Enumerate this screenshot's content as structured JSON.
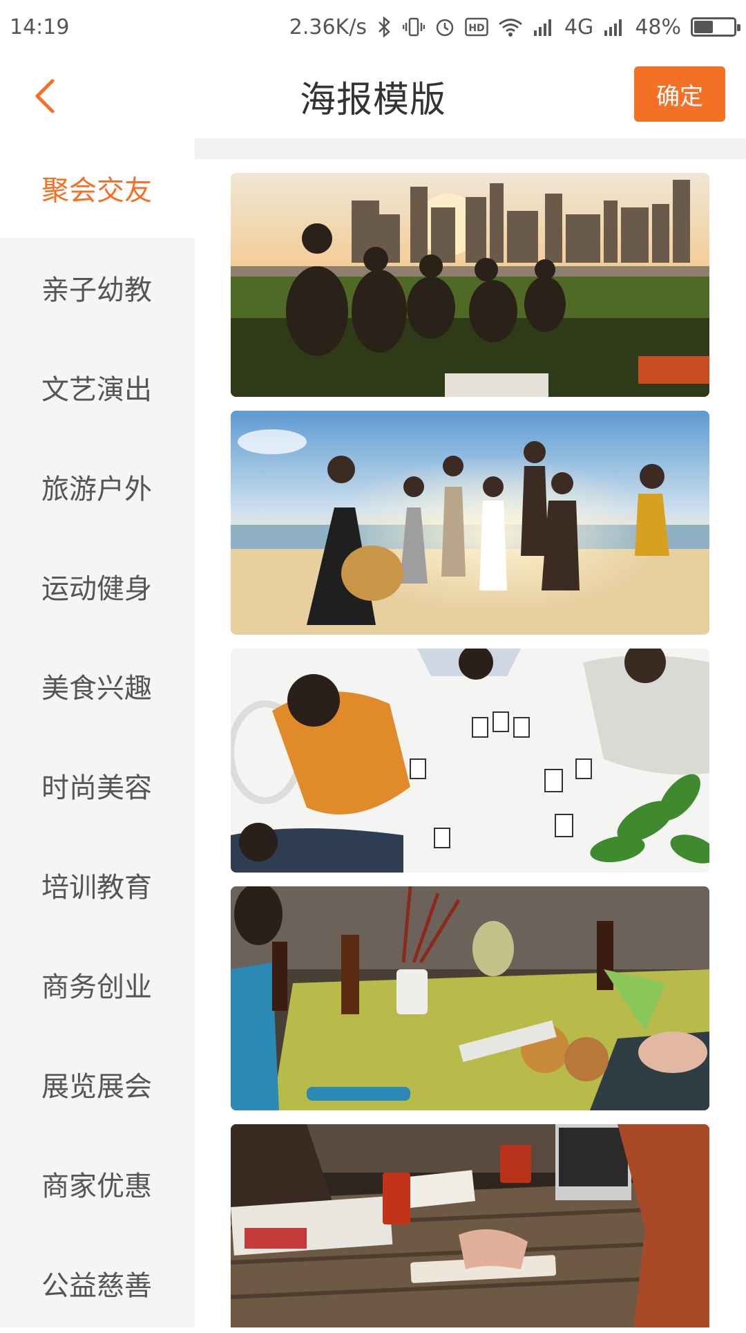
{
  "status_bar": {
    "time": "14:19",
    "speed": "2.36K/s",
    "network": "4G",
    "battery": "48%",
    "battery_level": 0.48,
    "icons": [
      "bluetooth-icon",
      "vibrate-icon",
      "alarm-icon",
      "hd-icon",
      "wifi-icon",
      "signal-icon",
      "signal-icon-2",
      "battery-icon"
    ]
  },
  "header": {
    "title": "海报模版",
    "confirm_label": "确定",
    "back_icon": "chevron-left-icon"
  },
  "sidebar": {
    "items": [
      {
        "label": "聚会交友",
        "active": true
      },
      {
        "label": "亲子幼教"
      },
      {
        "label": "文艺演出"
      },
      {
        "label": "旅游户外"
      },
      {
        "label": "运动健身"
      },
      {
        "label": "美食兴趣"
      },
      {
        "label": "时尚美容"
      },
      {
        "label": "培训教育"
      },
      {
        "label": "商务创业"
      },
      {
        "label": "展览展会"
      },
      {
        "label": "商家优惠"
      },
      {
        "label": "公益慈善"
      }
    ]
  },
  "templates": [
    {
      "scene": "group-picnic-city-sunset"
    },
    {
      "scene": "friends-jumping-beach"
    },
    {
      "scene": "card-game-table"
    },
    {
      "scene": "dinner-party-table"
    },
    {
      "scene": "cafe-study-table"
    }
  ],
  "colors": {
    "accent": "#f47024",
    "sidebar_bg": "#f5f5f5",
    "text": "#555555"
  }
}
